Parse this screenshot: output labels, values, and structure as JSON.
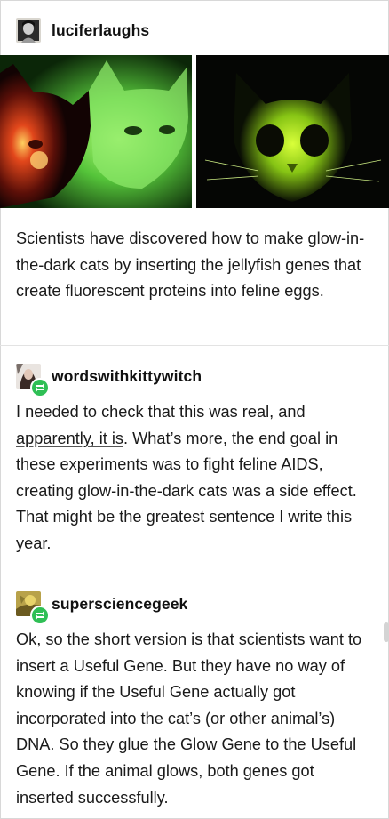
{
  "post": {
    "author": "luciferlaughs",
    "author_avatar_icon": "portrait-avatar-icon",
    "images": [
      {
        "name": "glowing-cats-photo",
        "alt_icon": "cat-photo-icon"
      },
      {
        "name": "glowing-cat-dark-photo",
        "alt_icon": "cat-photo-icon"
      }
    ],
    "text": "Scientists have discovered how to make glow-in-the-dark cats by  inserting the jellyfish genes that create fluorescent proteins into feline eggs."
  },
  "reblogs": [
    {
      "author": "wordswithkittywitch",
      "badge_icon": "reblog-icon",
      "text_before": "I needed to check that this was real, and ",
      "link_text": "apparently, it is",
      "text_after": ". What’s more, the end goal in these experiments was to fight feline AIDS, creating glow-in-the-dark cats was a side effect. That might be the greatest sentence I write this year."
    },
    {
      "author": "supersciencegeek",
      "badge_icon": "reblog-icon",
      "text": "Ok, so the short version is that scientists want to insert a Useful Gene. But they have no way of knowing if the Useful Gene actually got incorporated into the cat’s (or other animal’s) DNA. So they glue the Glow Gene to the Useful Gene. If the animal glows, both genes got inserted successfully."
    }
  ],
  "colors": {
    "reblog_badge": "#2fbf55",
    "divider": "#e3e3e3",
    "text": "#1a1a1a"
  }
}
